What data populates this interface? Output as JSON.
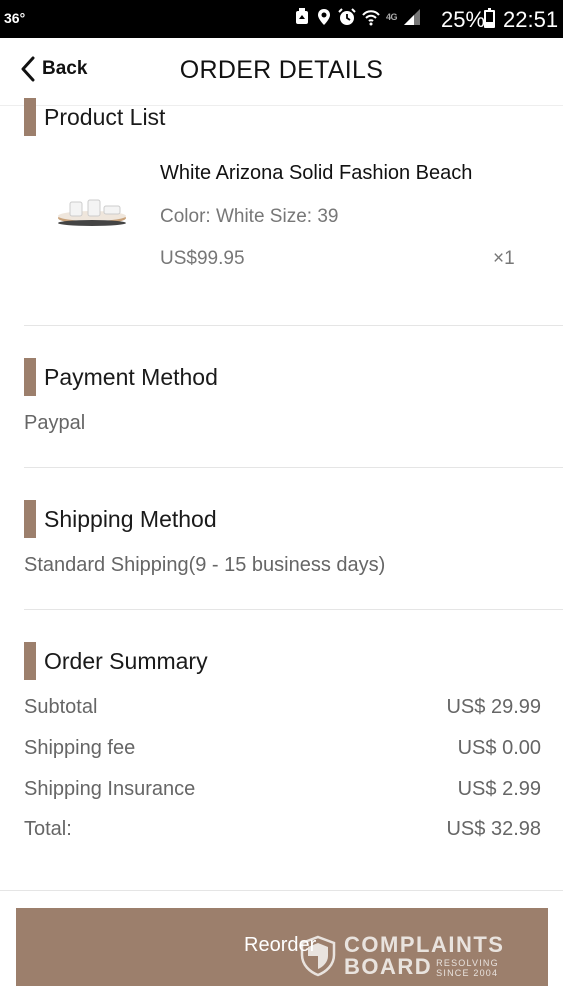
{
  "status_bar": {
    "temperature": "36°",
    "network_label": "4G",
    "battery_percent": "25%",
    "time": "22:51"
  },
  "header": {
    "back_label": "Back",
    "title": "ORDER DETAILS"
  },
  "product_list": {
    "title": "Product List",
    "items": [
      {
        "name": "White Arizona Solid Fashion Beach",
        "variant": "Color: White Size: 39",
        "price": "US$99.95",
        "quantity": "×1"
      }
    ]
  },
  "payment": {
    "title": "Payment Method",
    "value": "Paypal"
  },
  "shipping": {
    "title": "Shipping Method",
    "value": "Standard Shipping(9 - 15 business days)"
  },
  "summary": {
    "title": "Order Summary",
    "rows": [
      {
        "label": "Subtotal",
        "value": "US$ 29.99"
      },
      {
        "label": "Shipping fee",
        "value": "US$ 0.00"
      },
      {
        "label": "Shipping Insurance",
        "value": "US$ 2.99"
      },
      {
        "label": "Total:",
        "value": "US$ 32.98"
      }
    ]
  },
  "reorder_label": "Reorder",
  "watermark": {
    "line1": "COMPLAINTS",
    "line2": "BOARD",
    "tag1": "RESOLVING",
    "tag2": "SINCE 2004"
  },
  "colors": {
    "accent": "#9c7f6c",
    "status_bar": "#000000"
  }
}
